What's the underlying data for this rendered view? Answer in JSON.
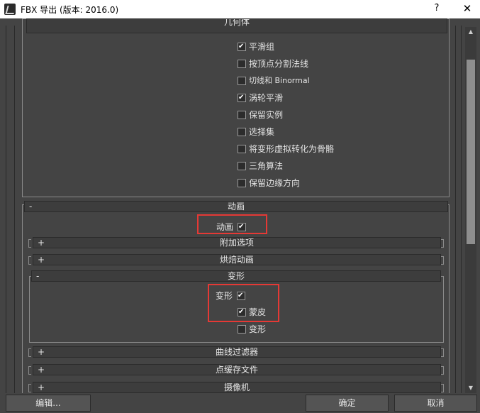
{
  "window": {
    "title": "FBX 导出 (版本: 2016.0)",
    "help_label": "?",
    "close_label": "✕"
  },
  "geometry": {
    "section_title": "几何体",
    "options": [
      {
        "label": "平滑组",
        "checked": true
      },
      {
        "label": "按顶点分割法线",
        "checked": false
      },
      {
        "label": "切线和 Binormal",
        "checked": false
      },
      {
        "label": "涡轮平滑",
        "checked": true
      },
      {
        "label": "保留实例",
        "checked": false
      },
      {
        "label": "选择集",
        "checked": false
      },
      {
        "label": "将变形虚拟转化为骨骼",
        "checked": false
      },
      {
        "label": "三角算法",
        "checked": false
      },
      {
        "label": "保留边缘方向",
        "checked": false
      }
    ]
  },
  "animation": {
    "sign": "-",
    "title": "动画",
    "checkbox_label": "动画",
    "checked": true,
    "extra_options": {
      "sign": "+",
      "title": "附加选项"
    },
    "bake_animation": {
      "sign": "+",
      "title": "烘焙动画"
    },
    "deformations": {
      "sign": "-",
      "title": "变形",
      "deform_label": "变形",
      "deform_checked": true,
      "skin_label": "蒙皮",
      "skin_checked": true,
      "morph_label": "变形",
      "morph_checked": false
    },
    "curve_filters": {
      "sign": "+",
      "title": "曲线过滤器"
    },
    "point_cache": {
      "sign": "+",
      "title": "点缓存文件"
    }
  },
  "cameras": {
    "sign": "+",
    "title": "摄像机"
  },
  "buttons": {
    "edit": "编辑...",
    "ok": "确定",
    "cancel": "取消"
  },
  "colors": {
    "highlight": "#e53935",
    "background": "#444444"
  }
}
